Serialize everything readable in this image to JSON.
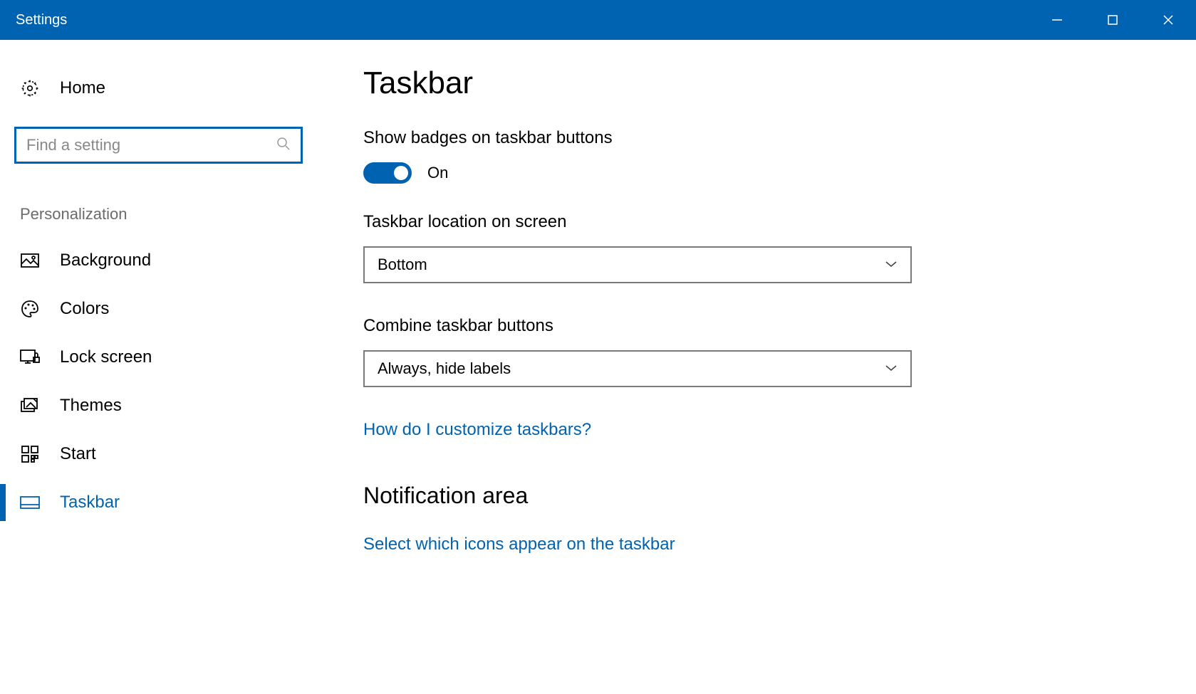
{
  "titlebar": {
    "title": "Settings"
  },
  "sidebar": {
    "home_label": "Home",
    "search_placeholder": "Find a setting",
    "section_header": "Personalization",
    "items": [
      {
        "label": "Background",
        "icon": "picture-icon",
        "active": false
      },
      {
        "label": "Colors",
        "icon": "palette-icon",
        "active": false
      },
      {
        "label": "Lock screen",
        "icon": "lock-screen-icon",
        "active": false
      },
      {
        "label": "Themes",
        "icon": "themes-icon",
        "active": false
      },
      {
        "label": "Start",
        "icon": "start-icon",
        "active": false
      },
      {
        "label": "Taskbar",
        "icon": "taskbar-icon",
        "active": true
      }
    ]
  },
  "main": {
    "page_title": "Taskbar",
    "badges_label": "Show badges on taskbar buttons",
    "badges_state": "On",
    "location_label": "Taskbar location on screen",
    "location_value": "Bottom",
    "combine_label": "Combine taskbar buttons",
    "combine_value": "Always, hide labels",
    "help_link": "How do I customize taskbars?",
    "notification_heading": "Notification area",
    "notification_link": "Select which icons appear on the taskbar"
  }
}
